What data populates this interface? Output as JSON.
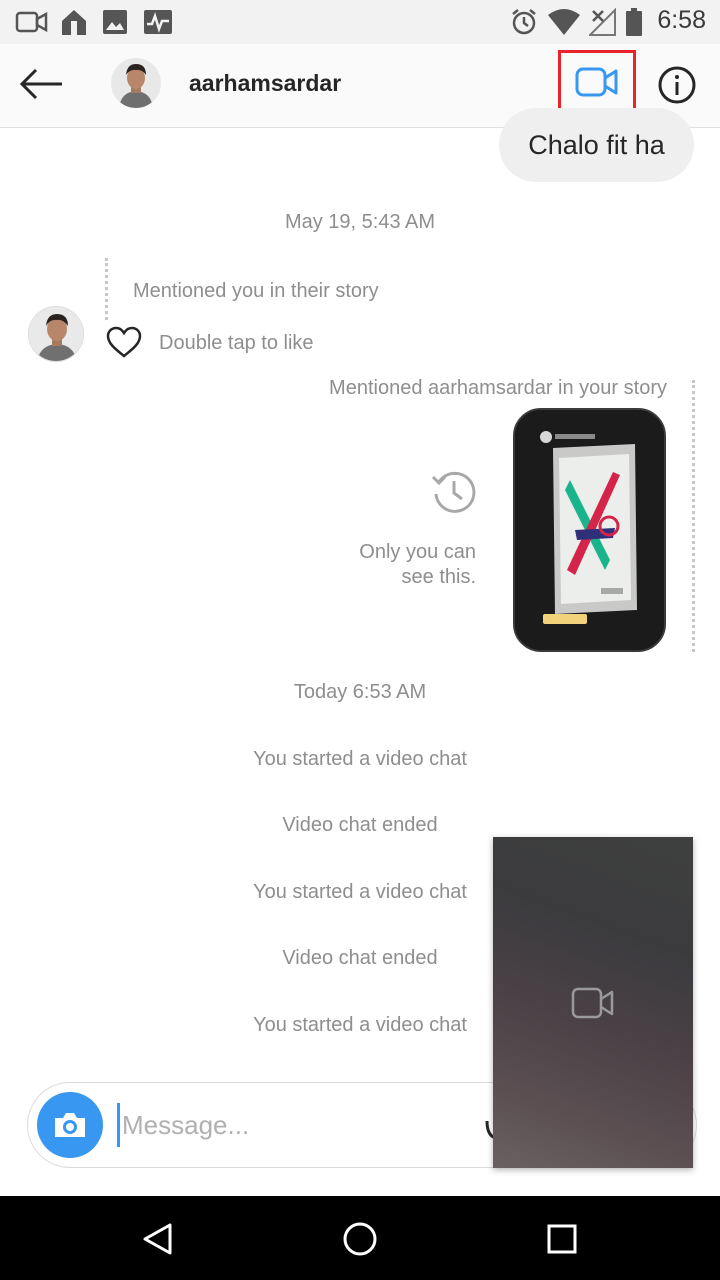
{
  "status_bar": {
    "time": "6:58",
    "left_icons": [
      "video-camera-icon",
      "home-like-icon",
      "image-icon",
      "activity-icon"
    ],
    "right_icons": [
      "alarm-icon",
      "wifi-icon",
      "no-signal-icon",
      "battery-icon"
    ]
  },
  "header": {
    "username": "aarhamsardar",
    "back_icon": "arrow-left-icon",
    "video_icon": "video-camera-icon",
    "info_icon": "info-icon",
    "highlight_color": "#e8232c",
    "accent_color": "#3897f0"
  },
  "chat": {
    "outgoing_message": "Chalo fit ha",
    "timestamp_1": "May 19, 5:43 AM",
    "incoming_mention": "Mentioned you in their story",
    "double_tap": "Double tap to like",
    "outgoing_mention": "Mentioned aarhamsardar in your story",
    "only_you_line1": "Only you can",
    "only_you_line2": "see this.",
    "timestamp_2": "Today 6:53 AM",
    "events": [
      "You started a video chat",
      "Video chat ended",
      "You started a video chat",
      "Video chat ended",
      "You started a video chat"
    ]
  },
  "composer": {
    "placeholder": "Message...",
    "camera_icon": "camera-icon"
  },
  "pip": {
    "icon": "video-camera-icon"
  },
  "nav": {
    "back": "triangle-back-icon",
    "home": "circle-home-icon",
    "recents": "square-recents-icon"
  }
}
